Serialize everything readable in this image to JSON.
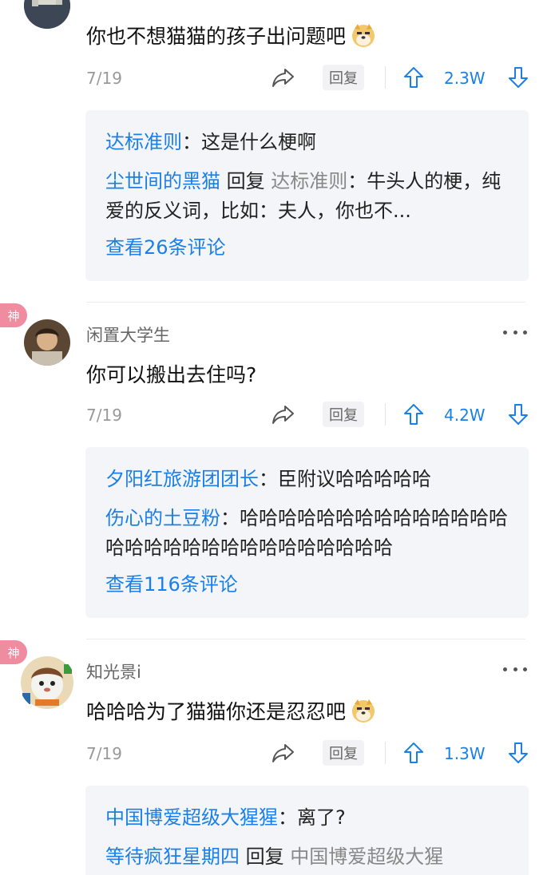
{
  "comments": [
    {
      "username": "",
      "text": "你也不想猫猫的孩子出问题吧",
      "date": "7/19",
      "reply_label": "回复",
      "votes": "2.3W",
      "god": false,
      "replies": [
        {
          "user": "达标准则",
          "sep": "：",
          "text": "这是什么梗啊"
        },
        {
          "user": "尘世间的黑猫",
          "reply_word": " 回复 ",
          "target": "达标准则",
          "sep": "：",
          "text": "牛头人的梗，纯爱的反义词，比如：夫人，你也不..."
        }
      ],
      "view_more": "查看26条评论"
    },
    {
      "username": "闲置大学生",
      "text": "你可以搬出去住吗?",
      "date": "7/19",
      "reply_label": "回复",
      "votes": "4.2W",
      "god": true,
      "god_label": "神",
      "replies": [
        {
          "user": "夕阳红旅游团团长",
          "sep": "：",
          "text": "臣附议哈哈哈哈哈"
        },
        {
          "user": "伤心的土豆粉",
          "sep": "：",
          "text": "哈哈哈哈哈哈哈哈哈哈哈哈哈哈哈哈哈哈哈哈哈哈哈哈哈哈哈哈哈"
        }
      ],
      "view_more": "查看116条评论"
    },
    {
      "username": "知光景i",
      "text": "哈哈哈为了猫猫你还是忍忍吧",
      "date": "7/19",
      "reply_label": "回复",
      "votes": "1.3W",
      "god": true,
      "god_label": "神",
      "replies": [
        {
          "user": "中国博爱超级大猩猩",
          "sep": "：",
          "text": "离了?"
        },
        {
          "user": "等待疯狂星期四",
          "reply_word": " 回复 ",
          "target": "中国博爱超级大猩",
          "sep": "",
          "text": ""
        }
      ]
    }
  ],
  "colors": {
    "accent": "#1a7fe8",
    "god_badge": "#f08ca0",
    "reply_bg": "#f4f5f8"
  },
  "icons": [
    "more-dots-icon",
    "share-icon",
    "upvote-arrow-icon",
    "downvote-arrow-icon",
    "doge-emoji-icon"
  ]
}
